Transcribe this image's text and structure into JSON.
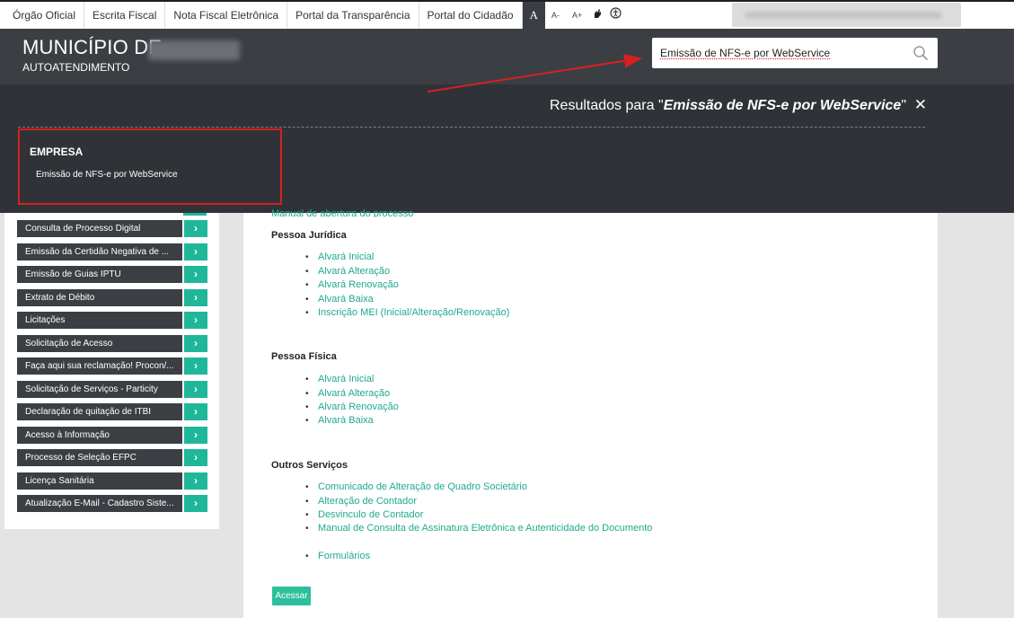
{
  "topbar": {
    "links": [
      "Órgão Oficial",
      "Escrita Fiscal",
      "Nota Fiscal Eletrônica",
      "Portal da Transparência",
      "Portal do Cidadão"
    ],
    "font_controls": [
      "A",
      "A-",
      "A+"
    ]
  },
  "header": {
    "title": "MUNICÍPIO DE",
    "subtitle": "AUTOATENDIMENTO",
    "search_value": "Emissão de NFS-e por WebService"
  },
  "results": {
    "prefix": "Resultados para \"",
    "query": "Emissão de NFS-e por WebService",
    "suffix": "\"",
    "close": "✕",
    "category": "EMPRESA",
    "item": "Emissão de NFS-e por WebService"
  },
  "sidebar": {
    "items": [
      "Consulta de Processo Digital",
      "Emissão da Certidão Negativa de ...",
      "Emissão de Guias IPTU",
      "Extrato de Débito",
      "Licitações",
      "Solicitação de Acesso",
      "Faça aqui sua reclamação! Procon/...",
      "Solicitação de Serviços - Particity",
      "Declaração de quitação de ITBI",
      "Acesso à Informação",
      "Processo de Seleção EFPC",
      "Licença Sanitária",
      "Atualização E-Mail - Cadastro Siste..."
    ],
    "arrow": "›"
  },
  "main": {
    "clipped_link": "Manual de abertura do processo",
    "pessoa_juridica": {
      "title": "Pessoa Jurídica",
      "links": [
        "Alvará Inicial",
        "Alvará Alteração",
        "Alvará Renovação",
        "Alvará Baixa",
        "Inscrição MEI (Inicial/Alteração/Renovação)"
      ]
    },
    "pessoa_fisica": {
      "title": "Pessoa Física",
      "links": [
        "Alvará Inicial",
        "Alvará Alteração",
        "Alvará Renovação",
        "Alvará Baixa"
      ]
    },
    "outros": {
      "title": "Outros Serviços",
      "links": [
        "Comunicado de Alteração de Quadro Societário",
        "Alteração de Contador",
        "Desvinculo de Contador",
        "Manual de Consulta de Assinatura Eletrônica e Autenticidade do Documento"
      ],
      "extra_link": "Formulários"
    },
    "access_button": "Acessar"
  },
  "colors": {
    "header_bg": "#3b3f44",
    "overlay_bg": "#2f3338",
    "accent": "#1fb79a",
    "link": "#1fa98f",
    "annotation": "#d72020"
  }
}
